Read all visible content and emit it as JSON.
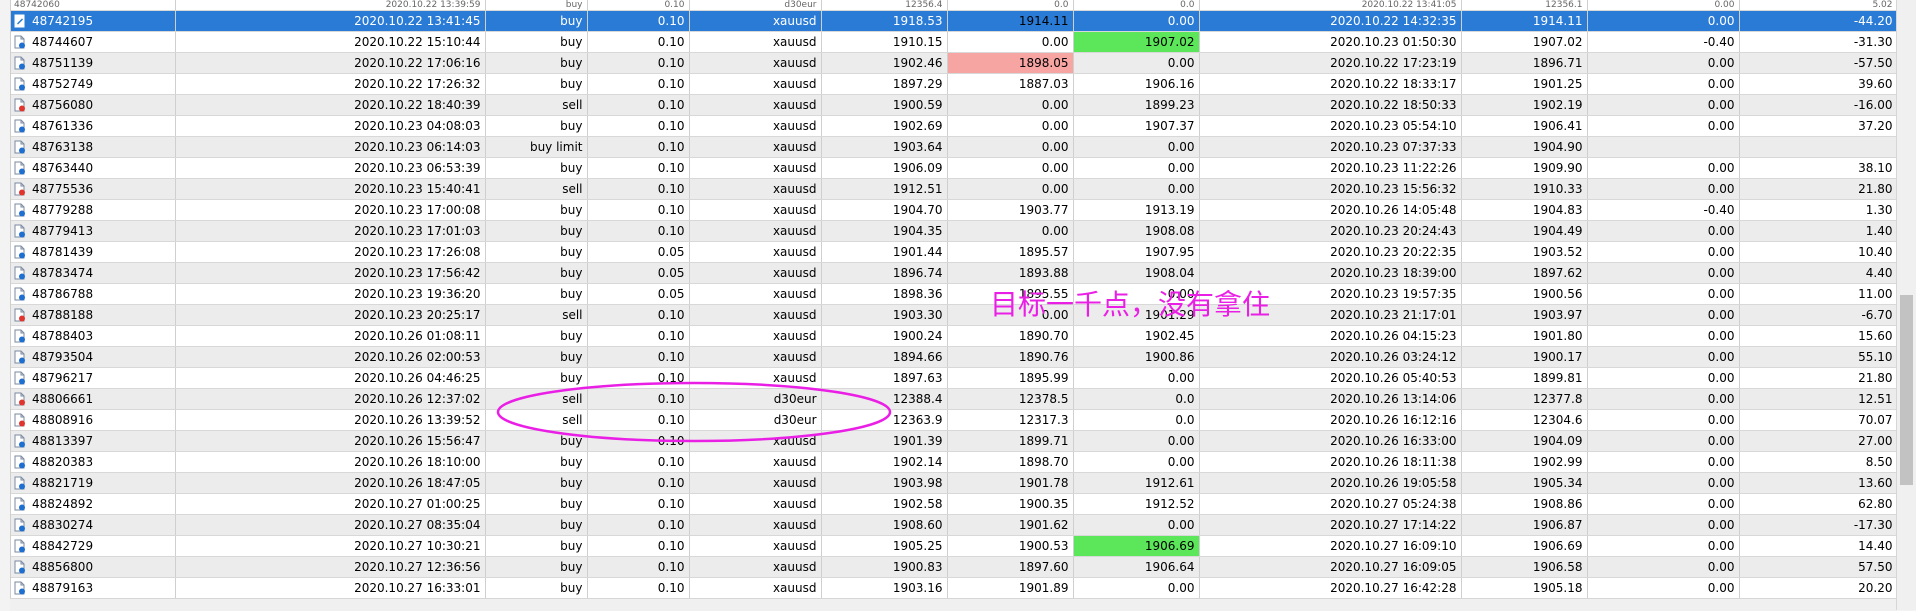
{
  "columns": [
    "ticket",
    "open_time",
    "type",
    "size",
    "symbol",
    "open_price",
    "sl",
    "tp",
    "close_time",
    "close_price",
    "commission",
    "profit"
  ],
  "top_row": [
    "48742060",
    "2020.10.22 13:39:59",
    "buy",
    "0.10",
    "d30eur",
    "12356.4",
    "0.0",
    "0.0",
    "2020.10.22 13:41:05",
    "12356.1",
    "0.00",
    "5.02"
  ],
  "rows": [
    {
      "ticket": "48742195",
      "open_time": "2020.10.22 13:41:45",
      "type": "buy",
      "size": "0.10",
      "symbol": "xauusd",
      "open_price": "1918.53",
      "sl": "1914.11",
      "tp": "0.00",
      "close_time": "2020.10.22 14:32:35",
      "close_price": "1914.11",
      "commission": "0.00",
      "profit": "-44.20",
      "icon": "doc-edit",
      "selected": true,
      "sl_hl": "red"
    },
    {
      "ticket": "48744607",
      "open_time": "2020.10.22 15:10:44",
      "type": "buy",
      "size": "0.10",
      "symbol": "xauusd",
      "open_price": "1910.15",
      "sl": "0.00",
      "tp": "1907.02",
      "close_time": "2020.10.23 01:50:30",
      "close_price": "1907.02",
      "commission": "-0.40",
      "profit": "-31.30",
      "icon": "doc-blue",
      "tp_hl": "green"
    },
    {
      "ticket": "48751139",
      "open_time": "2020.10.22 17:06:16",
      "type": "buy",
      "size": "0.10",
      "symbol": "xauusd",
      "open_price": "1902.46",
      "sl": "1898.05",
      "tp": "0.00",
      "close_time": "2020.10.22 17:23:19",
      "close_price": "1896.71",
      "commission": "0.00",
      "profit": "-57.50",
      "icon": "doc-blue",
      "sl_hl": "red"
    },
    {
      "ticket": "48752749",
      "open_time": "2020.10.22 17:26:32",
      "type": "buy",
      "size": "0.10",
      "symbol": "xauusd",
      "open_price": "1897.29",
      "sl": "1887.03",
      "tp": "1906.16",
      "close_time": "2020.10.22 18:33:17",
      "close_price": "1901.25",
      "commission": "0.00",
      "profit": "39.60",
      "icon": "doc-blue"
    },
    {
      "ticket": "48756080",
      "open_time": "2020.10.22 18:40:39",
      "type": "sell",
      "size": "0.10",
      "symbol": "xauusd",
      "open_price": "1900.59",
      "sl": "0.00",
      "tp": "1899.23",
      "close_time": "2020.10.22 18:50:33",
      "close_price": "1902.19",
      "commission": "0.00",
      "profit": "-16.00",
      "icon": "doc-red"
    },
    {
      "ticket": "48761336",
      "open_time": "2020.10.23 04:08:03",
      "type": "buy",
      "size": "0.10",
      "symbol": "xauusd",
      "open_price": "1902.69",
      "sl": "0.00",
      "tp": "1907.37",
      "close_time": "2020.10.23 05:54:10",
      "close_price": "1906.41",
      "commission": "0.00",
      "profit": "37.20",
      "icon": "doc-blue"
    },
    {
      "ticket": "48763138",
      "open_time": "2020.10.23 06:14:03",
      "type": "buy limit",
      "size": "0.10",
      "symbol": "xauusd",
      "open_price": "1903.64",
      "sl": "0.00",
      "tp": "0.00",
      "close_time": "2020.10.23 07:37:33",
      "close_price": "1904.90",
      "commission": "",
      "profit": "",
      "icon": "doc-blue"
    },
    {
      "ticket": "48763440",
      "open_time": "2020.10.23 06:53:39",
      "type": "buy",
      "size": "0.10",
      "symbol": "xauusd",
      "open_price": "1906.09",
      "sl": "0.00",
      "tp": "0.00",
      "close_time": "2020.10.23 11:22:26",
      "close_price": "1909.90",
      "commission": "0.00",
      "profit": "38.10",
      "icon": "doc-blue"
    },
    {
      "ticket": "48775536",
      "open_time": "2020.10.23 15:40:41",
      "type": "sell",
      "size": "0.10",
      "symbol": "xauusd",
      "open_price": "1912.51",
      "sl": "0.00",
      "tp": "0.00",
      "close_time": "2020.10.23 15:56:32",
      "close_price": "1910.33",
      "commission": "0.00",
      "profit": "21.80",
      "icon": "doc-red"
    },
    {
      "ticket": "48779288",
      "open_time": "2020.10.23 17:00:08",
      "type": "buy",
      "size": "0.10",
      "symbol": "xauusd",
      "open_price": "1904.70",
      "sl": "1903.77",
      "tp": "1913.19",
      "close_time": "2020.10.26 14:05:48",
      "close_price": "1904.83",
      "commission": "-0.40",
      "profit": "1.30",
      "icon": "doc-blue"
    },
    {
      "ticket": "48779413",
      "open_time": "2020.10.23 17:01:03",
      "type": "buy",
      "size": "0.10",
      "symbol": "xauusd",
      "open_price": "1904.35",
      "sl": "0.00",
      "tp": "1908.08",
      "close_time": "2020.10.23 20:24:43",
      "close_price": "1904.49",
      "commission": "0.00",
      "profit": "1.40",
      "icon": "doc-blue"
    },
    {
      "ticket": "48781439",
      "open_time": "2020.10.23 17:26:08",
      "type": "buy",
      "size": "0.05",
      "symbol": "xauusd",
      "open_price": "1901.44",
      "sl": "1895.57",
      "tp": "1907.95",
      "close_time": "2020.10.23 20:22:35",
      "close_price": "1903.52",
      "commission": "0.00",
      "profit": "10.40",
      "icon": "doc-blue"
    },
    {
      "ticket": "48783474",
      "open_time": "2020.10.23 17:56:42",
      "type": "buy",
      "size": "0.05",
      "symbol": "xauusd",
      "open_price": "1896.74",
      "sl": "1893.88",
      "tp": "1908.04",
      "close_time": "2020.10.23 18:39:00",
      "close_price": "1897.62",
      "commission": "0.00",
      "profit": "4.40",
      "icon": "doc-blue"
    },
    {
      "ticket": "48786788",
      "open_time": "2020.10.23 19:36:20",
      "type": "buy",
      "size": "0.05",
      "symbol": "xauusd",
      "open_price": "1898.36",
      "sl": "1895.55",
      "tp": "0.00",
      "close_time": "2020.10.23 19:57:35",
      "close_price": "1900.56",
      "commission": "0.00",
      "profit": "11.00",
      "icon": "doc-blue"
    },
    {
      "ticket": "48788188",
      "open_time": "2020.10.23 20:25:17",
      "type": "sell",
      "size": "0.10",
      "symbol": "xauusd",
      "open_price": "1903.30",
      "sl": "0.00",
      "tp": "1901.29",
      "close_time": "2020.10.23 21:17:01",
      "close_price": "1903.97",
      "commission": "0.00",
      "profit": "-6.70",
      "icon": "doc-red"
    },
    {
      "ticket": "48788403",
      "open_time": "2020.10.26 01:08:11",
      "type": "buy",
      "size": "0.10",
      "symbol": "xauusd",
      "open_price": "1900.24",
      "sl": "1890.70",
      "tp": "1902.45",
      "close_time": "2020.10.26 04:15:23",
      "close_price": "1901.80",
      "commission": "0.00",
      "profit": "15.60",
      "icon": "doc-blue"
    },
    {
      "ticket": "48793504",
      "open_time": "2020.10.26 02:00:53",
      "type": "buy",
      "size": "0.10",
      "symbol": "xauusd",
      "open_price": "1894.66",
      "sl": "1890.76",
      "tp": "1900.86",
      "close_time": "2020.10.26 03:24:12",
      "close_price": "1900.17",
      "commission": "0.00",
      "profit": "55.10",
      "icon": "doc-blue"
    },
    {
      "ticket": "48796217",
      "open_time": "2020.10.26 04:46:25",
      "type": "buy",
      "size": "0.10",
      "symbol": "xauusd",
      "open_price": "1897.63",
      "sl": "1895.99",
      "tp": "0.00",
      "close_time": "2020.10.26 05:40:53",
      "close_price": "1899.81",
      "commission": "0.00",
      "profit": "21.80",
      "icon": "doc-blue"
    },
    {
      "ticket": "48806661",
      "open_time": "2020.10.26 12:37:02",
      "type": "sell",
      "size": "0.10",
      "symbol": "d30eur",
      "open_price": "12388.4",
      "sl": "12378.5",
      "tp": "0.0",
      "close_time": "2020.10.26 13:14:06",
      "close_price": "12377.8",
      "commission": "0.00",
      "profit": "12.51",
      "icon": "doc-red"
    },
    {
      "ticket": "48808916",
      "open_time": "2020.10.26 13:39:52",
      "type": "sell",
      "size": "0.10",
      "symbol": "d30eur",
      "open_price": "12363.9",
      "sl": "12317.3",
      "tp": "0.0",
      "close_time": "2020.10.26 16:12:16",
      "close_price": "12304.6",
      "commission": "0.00",
      "profit": "70.07",
      "icon": "doc-red"
    },
    {
      "ticket": "48813397",
      "open_time": "2020.10.26 15:56:47",
      "type": "buy",
      "size": "0.10",
      "symbol": "xauusd",
      "open_price": "1901.39",
      "sl": "1899.71",
      "tp": "0.00",
      "close_time": "2020.10.26 16:33:00",
      "close_price": "1904.09",
      "commission": "0.00",
      "profit": "27.00",
      "icon": "doc-blue"
    },
    {
      "ticket": "48820383",
      "open_time": "2020.10.26 18:10:00",
      "type": "buy",
      "size": "0.10",
      "symbol": "xauusd",
      "open_price": "1902.14",
      "sl": "1898.70",
      "tp": "0.00",
      "close_time": "2020.10.26 18:11:38",
      "close_price": "1902.99",
      "commission": "0.00",
      "profit": "8.50",
      "icon": "doc-blue"
    },
    {
      "ticket": "48821719",
      "open_time": "2020.10.26 18:47:05",
      "type": "buy",
      "size": "0.10",
      "symbol": "xauusd",
      "open_price": "1903.98",
      "sl": "1901.78",
      "tp": "1912.61",
      "close_time": "2020.10.26 19:05:58",
      "close_price": "1905.34",
      "commission": "0.00",
      "profit": "13.60",
      "icon": "doc-blue"
    },
    {
      "ticket": "48824892",
      "open_time": "2020.10.27 01:00:25",
      "type": "buy",
      "size": "0.10",
      "symbol": "xauusd",
      "open_price": "1902.58",
      "sl": "1900.35",
      "tp": "1912.52",
      "close_time": "2020.10.27 05:24:38",
      "close_price": "1908.86",
      "commission": "0.00",
      "profit": "62.80",
      "icon": "doc-blue"
    },
    {
      "ticket": "48830274",
      "open_time": "2020.10.27 08:35:04",
      "type": "buy",
      "size": "0.10",
      "symbol": "xauusd",
      "open_price": "1908.60",
      "sl": "1901.62",
      "tp": "0.00",
      "close_time": "2020.10.27 17:14:22",
      "close_price": "1906.87",
      "commission": "0.00",
      "profit": "-17.30",
      "icon": "doc-blue"
    },
    {
      "ticket": "48842729",
      "open_time": "2020.10.27 10:30:21",
      "type": "buy",
      "size": "0.10",
      "symbol": "xauusd",
      "open_price": "1905.25",
      "sl": "1900.53",
      "tp": "1906.69",
      "close_time": "2020.10.27 16:09:10",
      "close_price": "1906.69",
      "commission": "0.00",
      "profit": "14.40",
      "icon": "doc-blue",
      "tp_hl": "green"
    },
    {
      "ticket": "48856800",
      "open_time": "2020.10.27 12:36:56",
      "type": "buy",
      "size": "0.10",
      "symbol": "xauusd",
      "open_price": "1900.83",
      "sl": "1897.60",
      "tp": "1906.64",
      "close_time": "2020.10.27 16:09:05",
      "close_price": "1906.58",
      "commission": "0.00",
      "profit": "57.50",
      "icon": "doc-blue"
    },
    {
      "ticket": "48879163",
      "open_time": "2020.10.27 16:33:01",
      "type": "buy",
      "size": "0.10",
      "symbol": "xauusd",
      "open_price": "1903.16",
      "sl": "1901.89",
      "tp": "0.00",
      "close_time": "2020.10.27 16:42:28",
      "close_price": "1905.18",
      "commission": "0.00",
      "profit": "20.20",
      "icon": "doc-blue"
    }
  ],
  "annotation": {
    "text": "目标一千点，没有拿住",
    "color": "#ea1fe6"
  },
  "colors": {
    "selected_row": "#2a7bd6",
    "sl_highlight": "#f6a5a2",
    "tp_highlight": "#5ce65a",
    "annotation": "#ea1fe6"
  }
}
